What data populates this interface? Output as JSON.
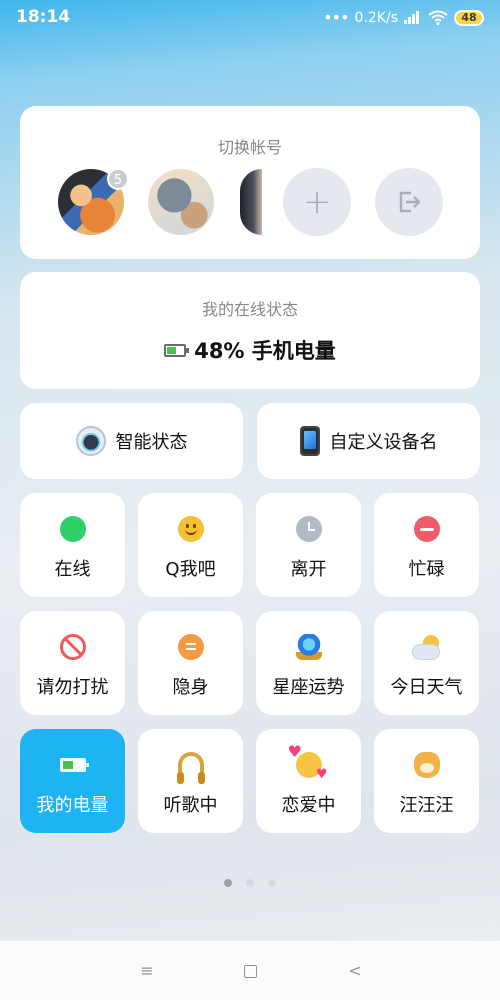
{
  "status_bar": {
    "time": "18:14",
    "network_speed": "0.2K/s",
    "battery_level": "48",
    "icons": [
      "signal-bars-icon",
      "wifi-icon",
      "battery-icon"
    ]
  },
  "accounts": {
    "title": "切换帐号",
    "unread_badge": "5",
    "add_icon": "+",
    "icons": [
      "plus-icon",
      "logout-icon"
    ]
  },
  "online_status": {
    "title": "我的在线状态",
    "battery_text": "48% 手机电量",
    "battery_fraction": 0.48
  },
  "wide_cards": [
    {
      "label": "智能状态",
      "icon": "robot-icon"
    },
    {
      "label": "自定义设备名",
      "icon": "phone-icon"
    }
  ],
  "tiles": [
    {
      "label": "在线",
      "icon": "online-dot-icon"
    },
    {
      "label": "Q我吧",
      "icon": "smiley-icon"
    },
    {
      "label": "离开",
      "icon": "clock-icon"
    },
    {
      "label": "忙碌",
      "icon": "busy-icon"
    },
    {
      "label": "请勿打扰",
      "icon": "no-disturb-icon"
    },
    {
      "label": "隐身",
      "icon": "invisible-icon"
    },
    {
      "label": "星座运势",
      "icon": "crystal-ball-icon"
    },
    {
      "label": "今日天气",
      "icon": "weather-icon"
    },
    {
      "label": "我的电量",
      "icon": "battery-icon",
      "active": true
    },
    {
      "label": "听歌中",
      "icon": "headphones-icon"
    },
    {
      "label": "恋爱中",
      "icon": "in-love-icon"
    },
    {
      "label": "汪汪汪",
      "icon": "dog-icon"
    }
  ],
  "pager": {
    "pages": 3,
    "current": 1
  },
  "nav_bar": {
    "menu_glyph": "≡",
    "back_glyph": "<",
    "icons": [
      "menu-icon",
      "home-icon",
      "back-icon"
    ]
  },
  "colors": {
    "accent": "#1eb3f3",
    "online": "#2fcf6a",
    "busy": "#ee5c6a"
  }
}
